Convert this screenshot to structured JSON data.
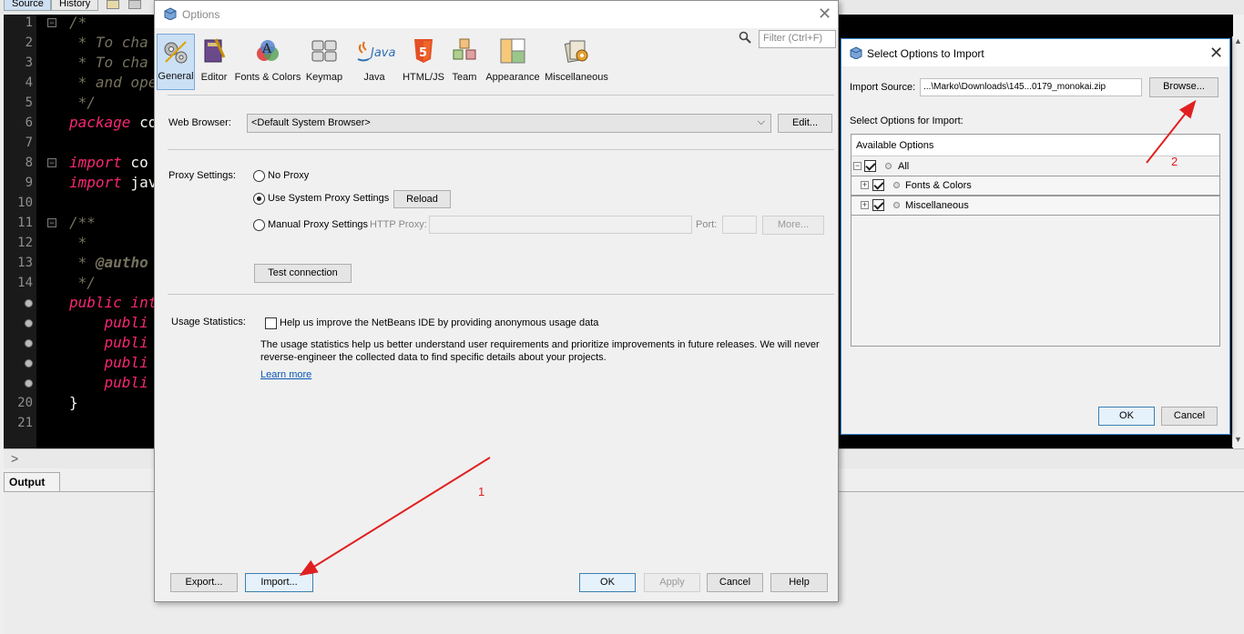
{
  "ide": {
    "tabs": [
      "Source",
      "History"
    ],
    "line_numbers": [
      "1",
      "2",
      "3",
      "4",
      "5",
      "6",
      "7",
      "8",
      "9",
      "10",
      "11",
      "12",
      "13",
      "14",
      "20",
      "21"
    ],
    "code_lines": [
      {
        "parts": [
          {
            "cls": "c-cmt",
            "t": "/*"
          }
        ]
      },
      {
        "parts": [
          {
            "cls": "c-cmt",
            "t": " * To cha"
          }
        ]
      },
      {
        "parts": [
          {
            "cls": "c-cmt",
            "t": " * To cha"
          }
        ]
      },
      {
        "parts": [
          {
            "cls": "c-cmt",
            "t": " * and ope"
          }
        ]
      },
      {
        "parts": [
          {
            "cls": "c-cmt",
            "t": " */"
          }
        ]
      },
      {
        "parts": [
          {
            "cls": "c-kw",
            "t": "package"
          },
          {
            "cls": "c-pl",
            "t": " co"
          }
        ]
      },
      {
        "parts": []
      },
      {
        "parts": [
          {
            "cls": "c-kw",
            "t": "import"
          },
          {
            "cls": "c-pl",
            "t": " co"
          }
        ]
      },
      {
        "parts": [
          {
            "cls": "c-kw",
            "t": "import"
          },
          {
            "cls": "c-pl",
            "t": " jav"
          }
        ]
      },
      {
        "parts": []
      },
      {
        "parts": [
          {
            "cls": "c-cmt",
            "t": "/**"
          }
        ]
      },
      {
        "parts": [
          {
            "cls": "c-cmt",
            "t": " *"
          }
        ]
      },
      {
        "parts": [
          {
            "cls": "c-cmt",
            "t": " * "
          },
          {
            "cls": "c-ann",
            "t": "@autho"
          }
        ]
      },
      {
        "parts": [
          {
            "cls": "c-cmt",
            "t": " */"
          }
        ]
      },
      {
        "parts": [
          {
            "cls": "c-kw",
            "t": "public int"
          }
        ]
      },
      {
        "parts": [
          {
            "cls": "c-kw",
            "t": "    publi"
          }
        ]
      },
      {
        "parts": [
          {
            "cls": "c-kw",
            "t": "    publi"
          }
        ]
      },
      {
        "parts": [
          {
            "cls": "c-kw",
            "t": "    publi"
          }
        ]
      },
      {
        "parts": [
          {
            "cls": "c-kw",
            "t": "    publi"
          }
        ]
      },
      {
        "parts": [
          {
            "cls": "c-pl",
            "t": "}"
          }
        ]
      },
      {
        "parts": []
      }
    ],
    "output_tab": "Output"
  },
  "options": {
    "title": "Options",
    "filter_placeholder": "Filter (Ctrl+F)",
    "categories": [
      "General",
      "Editor",
      "Fonts & Colors",
      "Keymap",
      "Java",
      "HTML/JS",
      "Team",
      "Appearance",
      "Miscellaneous"
    ],
    "java_logo_text": "Java",
    "web_browser": {
      "label": "Web Browser:",
      "value": "<Default System Browser>",
      "edit": "Edit..."
    },
    "proxy": {
      "label": "Proxy Settings:",
      "no_proxy": "No Proxy",
      "system_proxy": "Use System Proxy Settings",
      "reload": "Reload",
      "manual": "Manual Proxy Settings",
      "http_proxy": "HTTP Proxy:",
      "port": "Port:",
      "more": "More...",
      "test": "Test connection"
    },
    "usage": {
      "label": "Usage Statistics:",
      "checkbox": "Help us improve the NetBeans IDE by providing anonymous usage data",
      "desc1": "The usage statistics help us better understand user requirements and prioritize improvements in future releases. We will never",
      "desc2": "reverse-engineer the collected data to find specific details about your projects.",
      "learn_more": "Learn more"
    },
    "buttons": {
      "export": "Export...",
      "import": "Import...",
      "ok": "OK",
      "apply": "Apply",
      "cancel": "Cancel",
      "help": "Help"
    }
  },
  "import_dialog": {
    "title": "Select Options to Import",
    "source_label": "Import Source:",
    "source_value": "...\\Marko\\Downloads\\145...0179_monokai.zip",
    "browse": "Browse...",
    "options_label": "Select Options for Import:",
    "tree_header": "Available Options",
    "items": [
      "All",
      "Fonts & Colors",
      "Miscellaneous"
    ],
    "ok": "OK",
    "cancel": "Cancel"
  },
  "annotations": {
    "step1": "1",
    "step2": "2",
    "color": "#e02020"
  }
}
